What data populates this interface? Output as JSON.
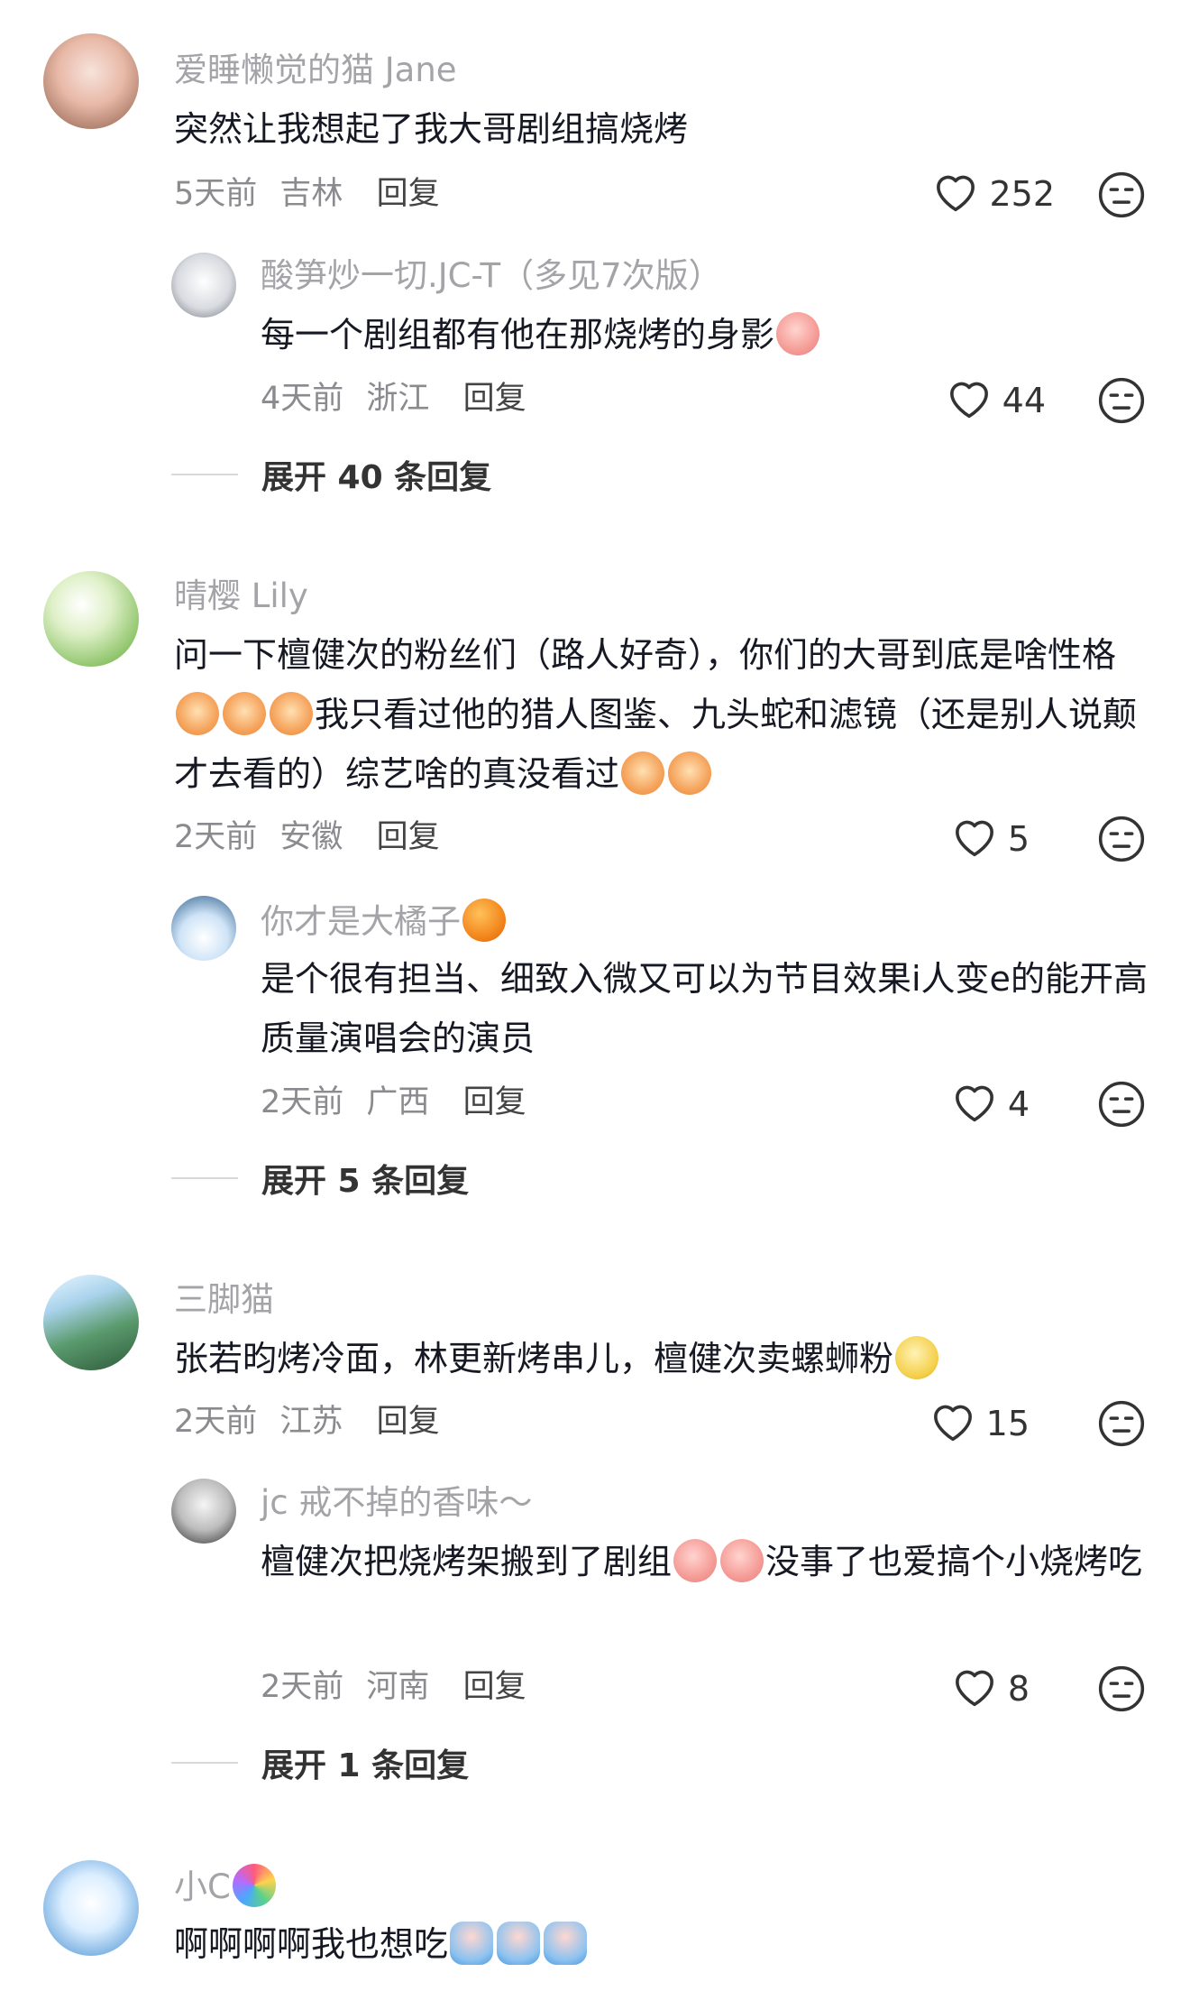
{
  "comments": [
    {
      "user": "爱睡懒觉的猫 Jane",
      "text": "突然让我想起了我大哥剧组搞烧烤",
      "time": "5天前",
      "location": "吉林",
      "reply_label": "回复",
      "likes": "252",
      "avatar_colors": [
        "#f3d9d2",
        "#b97a63"
      ]
    },
    {
      "user": "酸笋炒一切.JC-T（多见7次版）",
      "text": "每一个剧组都有他在那烧烤的身影",
      "time": "4天前",
      "location": "浙江",
      "reply_label": "回复",
      "likes": "44",
      "emoji": "peach-emoji",
      "avatar_colors": [
        "#f2f2f2",
        "#9aa0a8"
      ]
    },
    {
      "expand_label": "展开 40 条回复"
    },
    {
      "user": "晴樱 Lily",
      "text_part1": "问一下檀健次的粉丝们（路人好奇），你们的大哥到底是啥性格",
      "text_part2": "我只看过他的猎人图鉴、九头蛇和滤镜（还是别人说颠才去看的）综艺啥的真没看过",
      "time": "2天前",
      "location": "安徽",
      "reply_label": "回复",
      "likes": "5",
      "emoji": "crying-cat-emoji",
      "avatar_colors": [
        "#e9f6dc",
        "#7fb85a"
      ]
    },
    {
      "user": "你才是大橘子",
      "text": "是个很有担当、细致入微又可以为节目效果i人变e的能开高质量演唱会的演员",
      "time": "2天前",
      "location": "广西",
      "reply_label": "回复",
      "likes": "4",
      "emoji": "orange-emoji",
      "avatar_colors": [
        "#cfe4f7",
        "#2b5b8a"
      ]
    },
    {
      "expand_label": "展开 5 条回复"
    },
    {
      "user": "三脚猫",
      "text": "张若昀烤冷面，林更新烤串儿，檀健次卖螺蛳粉",
      "time": "2天前",
      "location": "江苏",
      "reply_label": "回复",
      "likes": "15",
      "emoji": "duck-emoji",
      "avatar_colors": [
        "#bfe0f0",
        "#3d7a4e"
      ]
    },
    {
      "user": "jc 戒不掉的香味～",
      "text_part1": "檀健次把烧烤架搬到了剧组",
      "text_part2": "没事了也爱搞个小烧烤吃",
      "time": "2天前",
      "location": "河南",
      "reply_label": "回复",
      "likes": "8",
      "emoji": "peach-emoji",
      "avatar_colors": [
        "#e9e9e9",
        "#333333"
      ]
    },
    {
      "expand_label": "展开 1 条回复"
    },
    {
      "user": "小C",
      "text": "啊啊啊啊我也想吃",
      "emoji": "bucket-emoji",
      "avatar_colors": [
        "#dbeeff",
        "#2f6fb0"
      ]
    }
  ],
  "colors": {
    "username": "#a3a3a8",
    "text": "#161823",
    "meta": "#8a8a8f"
  },
  "icons": [
    "heart-outline-icon",
    "dislike-face-icon"
  ]
}
